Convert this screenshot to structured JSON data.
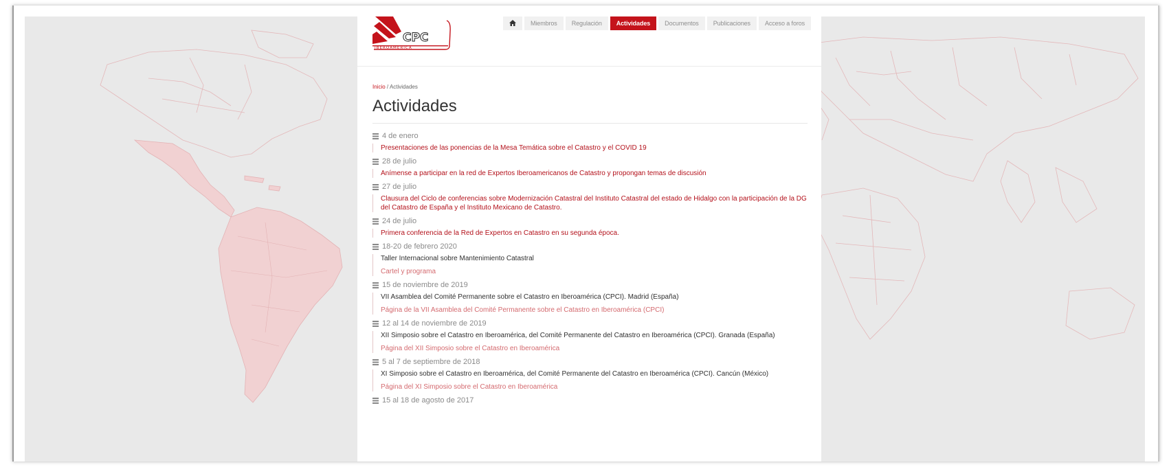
{
  "logo": {
    "text": "CPC",
    "subtext": "IBEROAMÉRICA"
  },
  "nav": {
    "items": [
      {
        "label": "",
        "icon": "home-icon"
      },
      {
        "label": "Miembros"
      },
      {
        "label": "Regulación"
      },
      {
        "label": "Actividades",
        "active": true
      },
      {
        "label": "Documentos"
      },
      {
        "label": "Publicaciones"
      },
      {
        "label": "Acceso a foros"
      }
    ]
  },
  "breadcrumb": {
    "home": "Inicio",
    "separator": "/",
    "current": "Actividades"
  },
  "page_title": "Actividades",
  "activities": [
    {
      "date": "4 de enero",
      "link": "Presentaciones de las ponencias de la Mesa Temática sobre el Catastro y el COVID 19"
    },
    {
      "date": "28 de julio",
      "link": "Anímense a participar en la red de Expertos Iberoamericanos de Catastro y propongan temas de discusión"
    },
    {
      "date": "27 de julio",
      "link": "Clausura del Ciclo de conferencias sobre Modernización Catastral del  Instituto Catastral del estado  de Hidalgo con la participación de la DG del Catastro de España y el Instituto Mexicano de Catastro."
    },
    {
      "date": "24 de julio",
      "link": "Primera conferencia de la Red de Expertos en Catastro en su segunda época."
    },
    {
      "date": "18-20 de febrero 2020",
      "text": "Taller Internacional sobre Mantenimiento Catastral",
      "sublink": "Cartel y programa"
    },
    {
      "date": "15 de noviembre de 2019",
      "text": "VII Asamblea del Comité Permanente sobre el Catastro en Iberoamérica (CPCI). Madrid (España)",
      "sublink": "Página de la VII Asamblea del Comité Permanente sobre el Catastro en Iberoamérica (CPCI)"
    },
    {
      "date": "12 al 14 de noviembre de 2019",
      "text": "XII Simposio sobre el Catastro en Iberoamérica, del Comité Permanente del Catastro en Iberoamérica (CPCI). Granada (España)",
      "sublink": "Página del XII Simposio sobre el Catastro en Iberoamérica"
    },
    {
      "date": "5 al 7 de septiembre de 2018",
      "text": "XI Simposio sobre el Catastro en Iberoamérica, del Comité Permanente del Catastro en Iberoamérica (CPCI). Cancún (México)",
      "sublink": "Página del XI Simposio sobre el Catastro en Iberoamérica"
    },
    {
      "date": "15 al 18 de agosto de 2017"
    }
  ],
  "colors": {
    "accent": "#c4131b",
    "map_fill": "#f1d1d2",
    "map_stroke": "#e3b2b4",
    "background": "#e9e9e9"
  }
}
